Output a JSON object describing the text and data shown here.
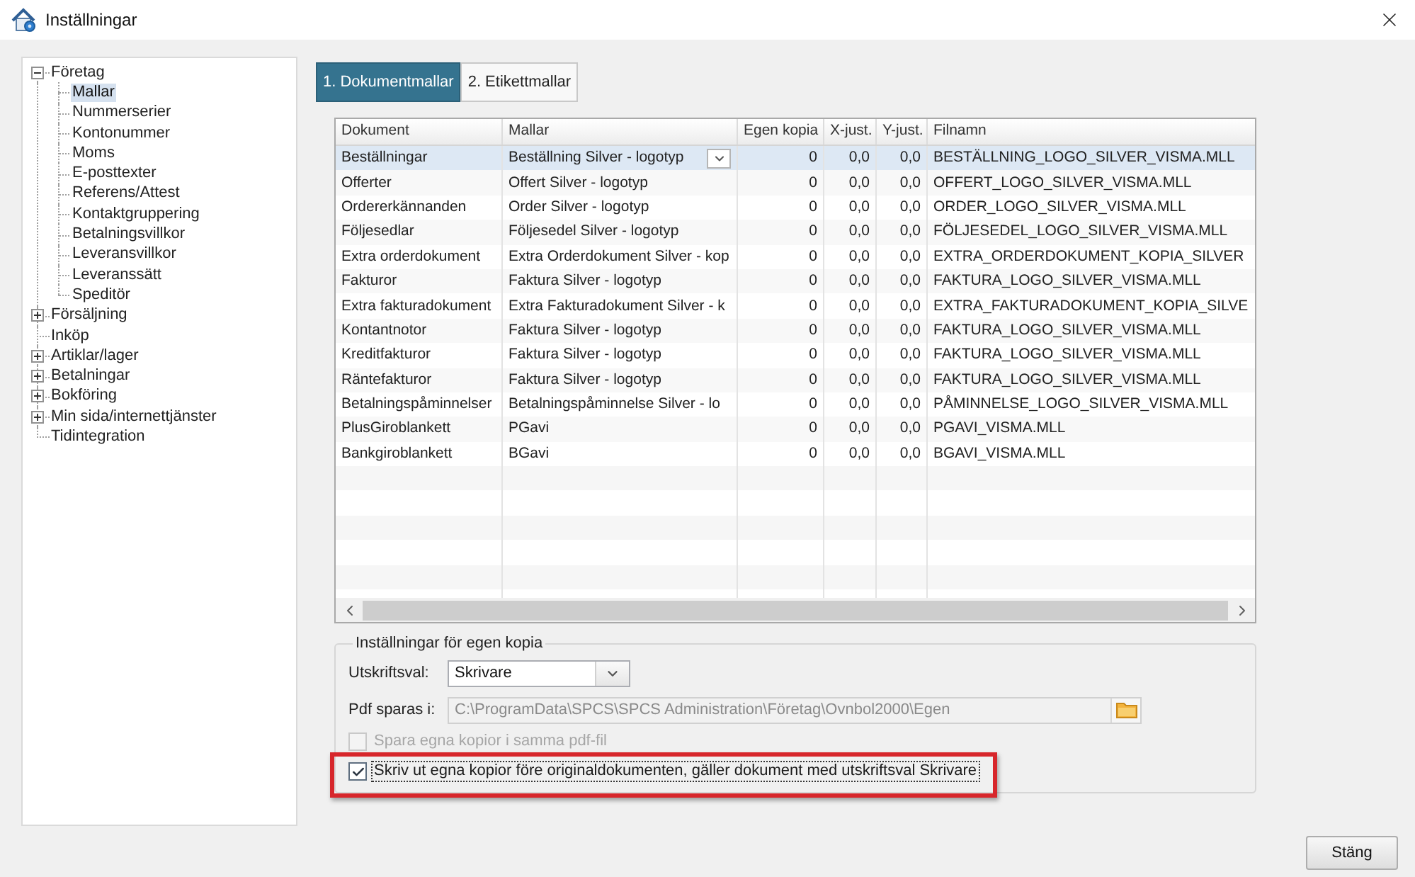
{
  "window": {
    "title": "Inställningar"
  },
  "sidebar": {
    "items": [
      {
        "kind": "group",
        "label": "Företag",
        "expanded": true,
        "selected": false,
        "children": [
          {
            "label": "Mallar",
            "selected": true
          },
          {
            "label": "Nummerserier",
            "selected": false
          },
          {
            "label": "Kontonummer",
            "selected": false
          },
          {
            "label": "Moms",
            "selected": false
          },
          {
            "label": "E-posttexter",
            "selected": false
          },
          {
            "label": "Referens/Attest",
            "selected": false
          },
          {
            "label": "Kontaktgruppering",
            "selected": false
          },
          {
            "label": "Betalningsvillkor",
            "selected": false
          },
          {
            "label": "Leveransvillkor",
            "selected": false
          },
          {
            "label": "Leveranssätt",
            "selected": false
          },
          {
            "label": "Speditör",
            "selected": false
          }
        ]
      },
      {
        "kind": "group",
        "label": "Försäljning",
        "expanded": false,
        "selected": false
      },
      {
        "kind": "leaf",
        "label": "Inköp",
        "selected": false
      },
      {
        "kind": "group",
        "label": "Artiklar/lager",
        "expanded": false,
        "selected": false
      },
      {
        "kind": "group",
        "label": "Betalningar",
        "expanded": false,
        "selected": false
      },
      {
        "kind": "group",
        "label": "Bokföring",
        "expanded": false,
        "selected": false
      },
      {
        "kind": "group",
        "label": "Min sida/internettjänster",
        "expanded": false,
        "selected": false
      },
      {
        "kind": "leaf",
        "label": "Tidintegration",
        "selected": false
      }
    ]
  },
  "tabs": [
    {
      "label": "1. Dokumentmallar",
      "selected": true
    },
    {
      "label": "2. Etikettmallar",
      "selected": false
    }
  ],
  "table": {
    "columns": [
      {
        "label": "Dokument",
        "kind": "text"
      },
      {
        "label": "Mallar",
        "kind": "combo"
      },
      {
        "label": "Egen kopia",
        "kind": "number"
      },
      {
        "label": "X-just.",
        "kind": "number"
      },
      {
        "label": "Y-just.",
        "kind": "number"
      },
      {
        "label": "Filnamn",
        "kind": "text"
      }
    ],
    "rows": [
      {
        "selected": true,
        "cells": [
          "Beställningar",
          "Beställning Silver - logotyp",
          "0",
          "0,0",
          "0,0",
          "BESTÄLLNING_LOGO_SILVER_VISMA.MLL"
        ]
      },
      {
        "selected": false,
        "cells": [
          "Offerter",
          "Offert Silver - logotyp",
          "0",
          "0,0",
          "0,0",
          "OFFERT_LOGO_SILVER_VISMA.MLL"
        ]
      },
      {
        "selected": false,
        "cells": [
          "Ordererkännanden",
          "Order Silver - logotyp",
          "0",
          "0,0",
          "0,0",
          "ORDER_LOGO_SILVER_VISMA.MLL"
        ]
      },
      {
        "selected": false,
        "cells": [
          "Följesedlar",
          "Följesedel Silver - logotyp",
          "0",
          "0,0",
          "0,0",
          "FÖLJESEDEL_LOGO_SILVER_VISMA.MLL"
        ]
      },
      {
        "selected": false,
        "cells": [
          "Extra orderdokument",
          "Extra Orderdokument Silver - kop",
          "0",
          "0,0",
          "0,0",
          "EXTRA_ORDERDOKUMENT_KOPIA_SILVER"
        ]
      },
      {
        "selected": false,
        "cells": [
          "Fakturor",
          "Faktura Silver - logotyp",
          "0",
          "0,0",
          "0,0",
          "FAKTURA_LOGO_SILVER_VISMA.MLL"
        ]
      },
      {
        "selected": false,
        "cells": [
          "Extra fakturadokument",
          "Extra Fakturadokument Silver - k",
          "0",
          "0,0",
          "0,0",
          "EXTRA_FAKTURADOKUMENT_KOPIA_SILVE"
        ]
      },
      {
        "selected": false,
        "cells": [
          "Kontantnotor",
          "Faktura Silver - logotyp",
          "0",
          "0,0",
          "0,0",
          "FAKTURA_LOGO_SILVER_VISMA.MLL"
        ]
      },
      {
        "selected": false,
        "cells": [
          "Kreditfakturor",
          "Faktura Silver - logotyp",
          "0",
          "0,0",
          "0,0",
          "FAKTURA_LOGO_SILVER_VISMA.MLL"
        ]
      },
      {
        "selected": false,
        "cells": [
          "Räntefakturor",
          "Faktura Silver - logotyp",
          "0",
          "0,0",
          "0,0",
          "FAKTURA_LOGO_SILVER_VISMA.MLL"
        ]
      },
      {
        "selected": false,
        "cells": [
          "Betalningspåminnelser",
          "Betalningspåminnelse Silver - lo",
          "0",
          "0,0",
          "0,0",
          "PÅMINNELSE_LOGO_SILVER_VISMA.MLL"
        ]
      },
      {
        "selected": false,
        "cells": [
          "PlusGiroblankett",
          "PGavi",
          "0",
          "0,0",
          "0,0",
          "PGAVI_VISMA.MLL"
        ]
      },
      {
        "selected": false,
        "cells": [
          "Bankgiroblankett",
          "BGavi",
          "0",
          "0,0",
          "0,0",
          "BGAVI_VISMA.MLL"
        ]
      }
    ]
  },
  "own_copy_settings": {
    "title": "Inställningar för egen kopia",
    "print_choice": {
      "label": "Utskriftsval:",
      "value": "Skrivare"
    },
    "pdf_folder": {
      "label": "Pdf sparas i:",
      "value": "C:\\ProgramData\\SPCS\\SPCS Administration\\Företag\\Ovnbol2000\\Egen",
      "disabled": true
    },
    "checkboxes": [
      {
        "label": "Spara egna kopior i samma pdf-fil",
        "checked": false,
        "disabled": true,
        "focused": false
      },
      {
        "label": "Skriv ut egna kopior före originaldokumenten, gäller dokument med utskriftsval Skrivare",
        "checked": true,
        "disabled": false,
        "focused": true
      }
    ]
  },
  "buttons": [
    {
      "label": "Stäng"
    }
  ]
}
